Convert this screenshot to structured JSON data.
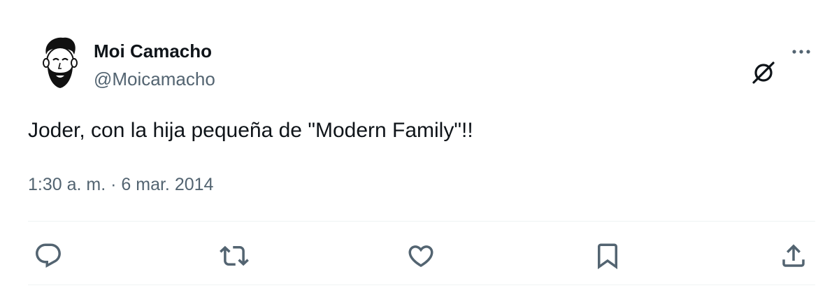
{
  "author": {
    "name": "Moi Camacho",
    "handle": "@Moicamacho"
  },
  "tweet": {
    "text": "Joder, con la hija pequeña de \"Modern Family\"!!",
    "time": "1:30 a. m.",
    "separator": "·",
    "date": "6 mar. 2014"
  },
  "actions": [
    "reply-icon",
    "retweet-icon",
    "like-icon",
    "bookmark-icon",
    "share-icon"
  ],
  "colors": {
    "text": "#0f1419",
    "secondary": "#536471",
    "divider": "#eff3f4",
    "icon": "#536471"
  }
}
